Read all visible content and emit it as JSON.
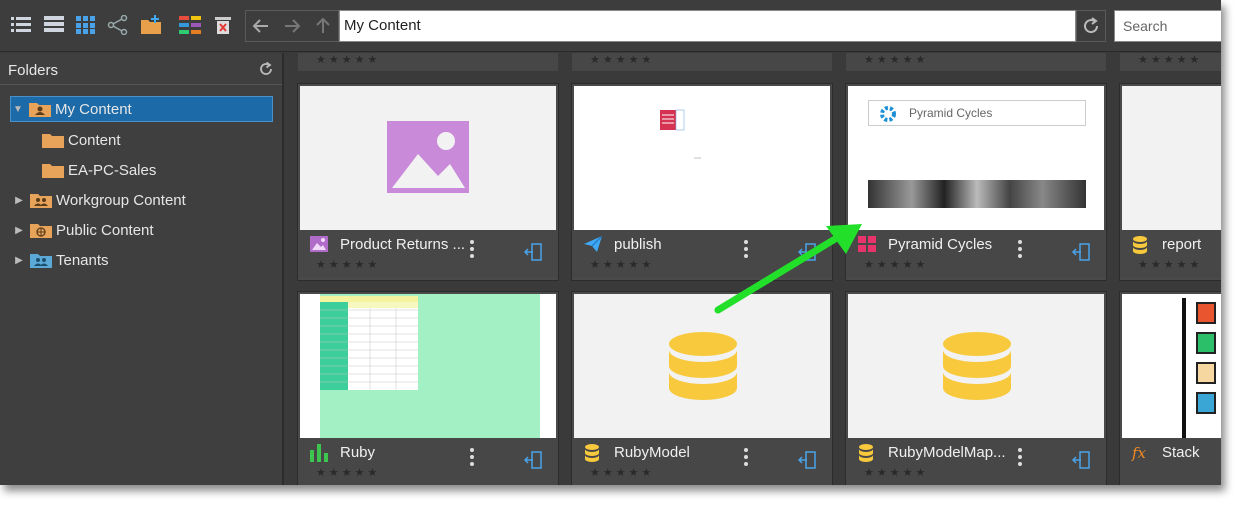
{
  "toolbar": {
    "icons": [
      "list-view-icon",
      "detail-view-icon",
      "grid-view-icon",
      "share-icon",
      "new-folder-icon",
      "palette-icon",
      "delete-icon"
    ],
    "path_value": "My Content",
    "search_placeholder": "Search"
  },
  "sidebar": {
    "header": "Folders",
    "items": [
      {
        "label": "My Content"
      },
      {
        "label": "Content"
      },
      {
        "label": "EA-PC-Sales"
      },
      {
        "label": "Workgroup Content"
      },
      {
        "label": "Public Content"
      },
      {
        "label": "Tenants"
      }
    ]
  },
  "cards": [
    {
      "title": "Product Returns ...",
      "icon": "image-icon",
      "thumb": "image-placeholder",
      "rating": "★★★★★"
    },
    {
      "title": "publish",
      "icon": "paper-plane-icon",
      "thumb": "small-doc",
      "rating": "★★★★★"
    },
    {
      "title": "Pyramid Cycles",
      "icon": "tiles-icon",
      "thumb": "branding",
      "thumb_text": "Pyramid Cycles",
      "rating": "★★★★★"
    },
    {
      "title": "report",
      "icon": "database-icon",
      "thumb": "report",
      "rating": "★★★★★"
    },
    {
      "title": "Ruby",
      "icon": "bar-chart-icon",
      "thumb": "spreadsheet",
      "rating": "★★★★★"
    },
    {
      "title": "RubyModel",
      "icon": "database-icon",
      "thumb": "database",
      "rating": "★★★★★"
    },
    {
      "title": "RubyModelMap...",
      "icon": "database-icon",
      "thumb": "database",
      "rating": "★★★★★"
    },
    {
      "title": "Stack",
      "icon": "fx-icon",
      "thumb": "stack",
      "rating": "★★★★★"
    }
  ],
  "colors": {
    "accent_blue": "#1c6aa8",
    "arrow_green": "#22e02a",
    "database_yellow": "#f8c93c",
    "image_purple": "#c98ad9"
  }
}
